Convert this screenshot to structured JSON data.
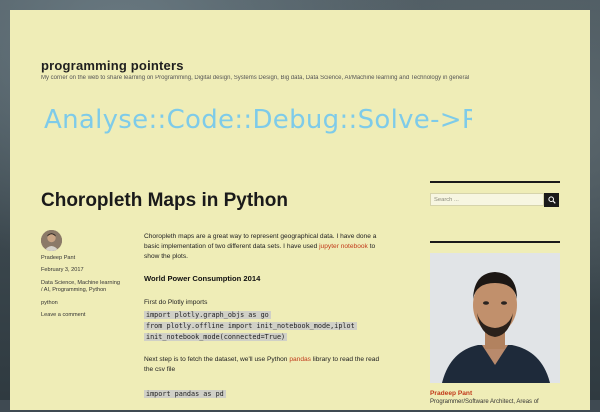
{
  "site": {
    "title": "programming pointers",
    "description": "My corner on the web to share learning on Programming, Digital design, Systems Design, Big data, Data Science, AI/Machine learning and Technology in general",
    "banner_text": "Analyse::Code::Debug::Solve->Repe"
  },
  "post": {
    "title": "Choropleth Maps in Python",
    "meta": {
      "author": "Pradeep Pant",
      "date": "February 3, 2017",
      "categories": "Data Science, Machine learning / AI, Programming, Python",
      "tag": "python",
      "comment_link": "Leave a comment"
    },
    "intro_before_link": "Choropleth maps are a great way to represent geographical data. I have done a basic implementation of two different data sets. I have used ",
    "intro_link": "jupyter notebook",
    "intro_after_link": " to show the plots.",
    "heading": "World Power Consumption 2014",
    "import_text": "First do Plotly imports",
    "code_lines": [
      "import plotly.graph_objs as go",
      "from plotly.offline import init_notebook_mode,iplot",
      "init_notebook_mode(connected=True)"
    ],
    "fetch_before_link": "Next step is to fetch the dataset, we'll use Python ",
    "fetch_link": "pandas",
    "fetch_after_link": " library to read the read the csv file",
    "code_line_2": "import pandas as pd"
  },
  "sidebar": {
    "search_placeholder": "Search ...",
    "author_name": "Pradeep Pant",
    "author_bio": "Programmer/Software Architect, Areas of"
  },
  "icons": {
    "search": "search-icon",
    "avatar": "avatar"
  }
}
